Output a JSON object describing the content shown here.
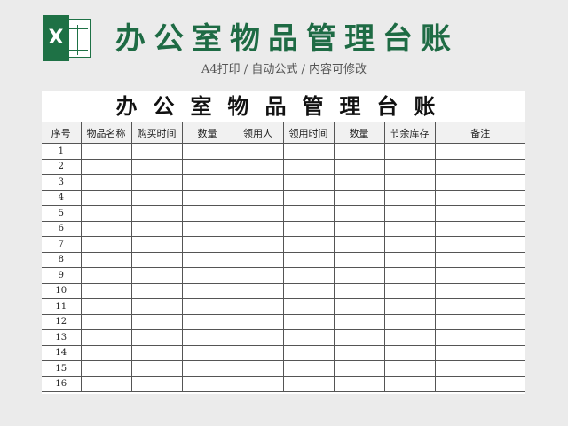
{
  "banner": {
    "logo_letter": "X",
    "title": "办公室物品管理台账",
    "subtitle": "A4打印 / 自动公式 / 内容可修改",
    "accent_color": "#1e6b44",
    "logo_color": "#1e7145",
    "logo_icon": "excel-icon"
  },
  "sheet": {
    "title": "办公室物品管理台账",
    "columns": [
      "序号",
      "物品名称",
      "购买时间",
      "数量",
      "领用人",
      "领用时间",
      "数量",
      "节余库存",
      "备注"
    ],
    "row_numbers": [
      "1",
      "2",
      "3",
      "4",
      "5",
      "6",
      "7",
      "8",
      "9",
      "10",
      "11",
      "12",
      "13",
      "14",
      "15",
      "16"
    ]
  }
}
